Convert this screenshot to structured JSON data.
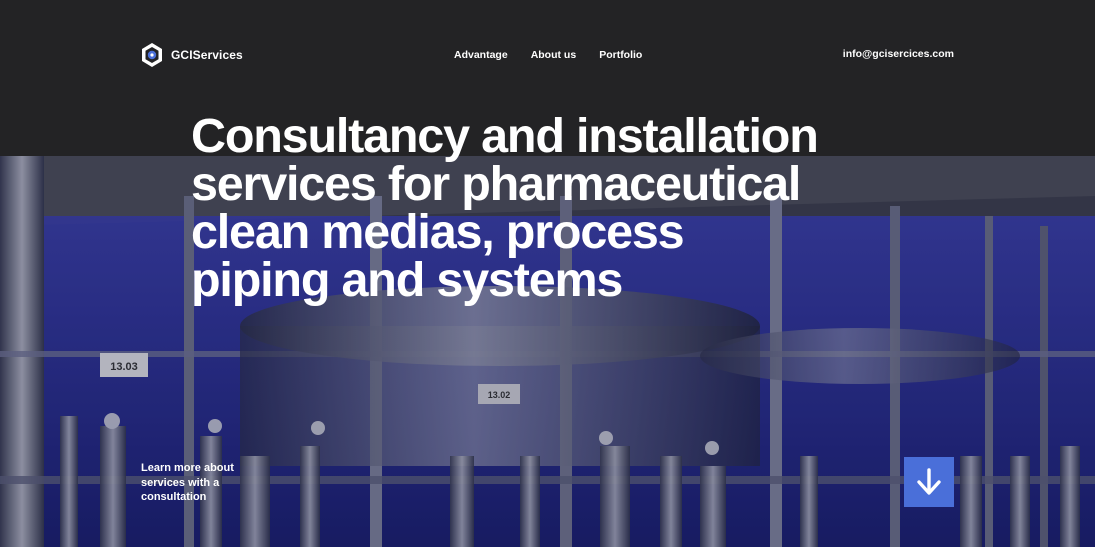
{
  "header": {
    "brand": "GCIServices",
    "nav": [
      "Advantage",
      "About us",
      "Portfolio"
    ],
    "email": "info@gcisercices.com"
  },
  "hero": {
    "headline_lines": [
      "Consultancy and installation",
      "services for pharmaceutical",
      "clean medias, process",
      "piping and systems"
    ],
    "cta_lines": [
      "Learn more about",
      "services with a",
      "consultation"
    ],
    "tank_labels": [
      "13.03",
      "13.02"
    ]
  },
  "colors": {
    "header_bg": "#232325",
    "hero_tint": "#1f2475",
    "accent": "#4a6fd9",
    "text": "#ffffff"
  },
  "icons": {
    "logo": "hexagon-gear-icon",
    "scroll": "arrow-down-icon"
  }
}
